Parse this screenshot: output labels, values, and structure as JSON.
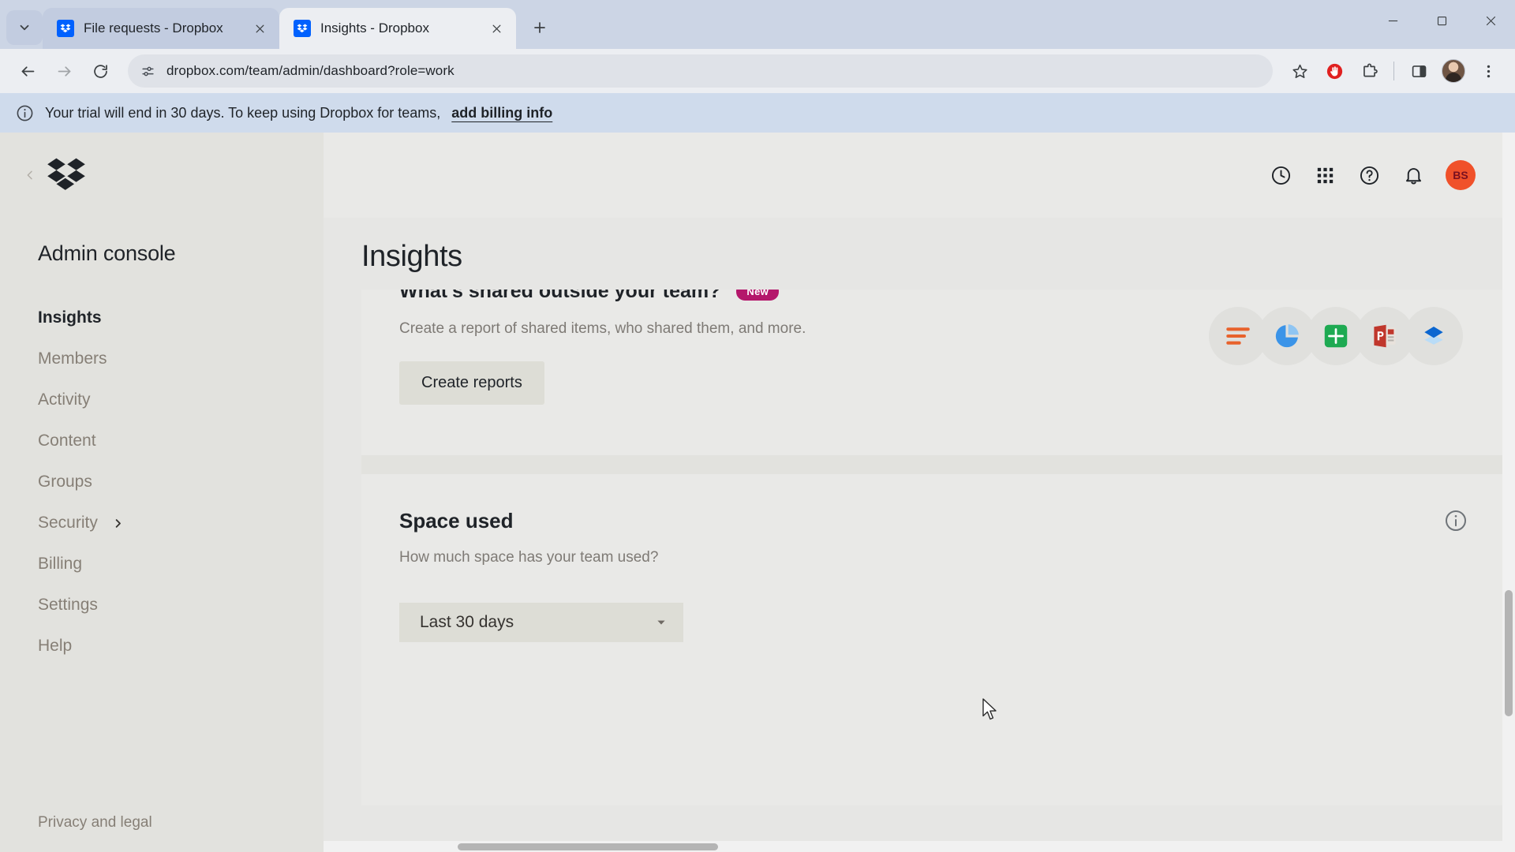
{
  "browser": {
    "tabs": [
      {
        "title": "File requests - Dropbox",
        "favicon": "dropbox-icon",
        "active": false
      },
      {
        "title": "Insights - Dropbox",
        "favicon": "dropbox-icon",
        "active": true
      }
    ],
    "new_tab_label": "+",
    "nav": {
      "back": "back-arrow",
      "forward": "forward-arrow",
      "reload": "reload-icon"
    },
    "omnibox": {
      "url": "dropbox.com/team/admin/dashboard?role=work",
      "site_info_icon": "site-settings-icon"
    },
    "toolbar_icons": [
      "bookmark-star-icon",
      "adblock-icon",
      "extensions-icon",
      "side-panel-icon",
      "profile-avatar",
      "browser-menu-icon"
    ],
    "window_controls": [
      "minimize",
      "maximize",
      "close"
    ]
  },
  "banner": {
    "icon": "info-circle-icon",
    "text": "Your trial will end in 30 days. To keep using Dropbox for teams,",
    "link": "add billing info"
  },
  "sidebar": {
    "logo": "dropbox-logo",
    "collapse_icon": "chevron-left-icon",
    "title": "Admin console",
    "items": [
      {
        "label": "Insights",
        "active": true,
        "has_chevron": false
      },
      {
        "label": "Members",
        "active": false,
        "has_chevron": false
      },
      {
        "label": "Activity",
        "active": false,
        "has_chevron": false
      },
      {
        "label": "Content",
        "active": false,
        "has_chevron": false
      },
      {
        "label": "Groups",
        "active": false,
        "has_chevron": false
      },
      {
        "label": "Security",
        "active": false,
        "has_chevron": true
      },
      {
        "label": "Billing",
        "active": false,
        "has_chevron": false
      },
      {
        "label": "Settings",
        "active": false,
        "has_chevron": false
      },
      {
        "label": "Help",
        "active": false,
        "has_chevron": false
      }
    ],
    "footer": "Privacy and legal"
  },
  "header": {
    "icons": [
      "clock-icon",
      "apps-grid-icon",
      "help-circle-icon",
      "bell-icon"
    ],
    "avatar_initials": "BS",
    "avatar_color": "#f0512a"
  },
  "main": {
    "page_title": "Insights",
    "cards": [
      {
        "title": "What's shared outside your team?",
        "badge": "New",
        "subtitle": "Create a report of shared items, who shared them, and more.",
        "button": "Create reports",
        "apps": [
          "bar-chart-icon",
          "pie-chart-icon",
          "sheets-icon",
          "powerpoint-icon",
          "dropbox-paper-icon"
        ]
      },
      {
        "title": "Space used",
        "subtitle": "How much space has your team used?",
        "info_icon": "info-circle-icon",
        "dropdown": {
          "value": "Last 30 days",
          "caret": "chevron-down-icon"
        }
      }
    ]
  }
}
